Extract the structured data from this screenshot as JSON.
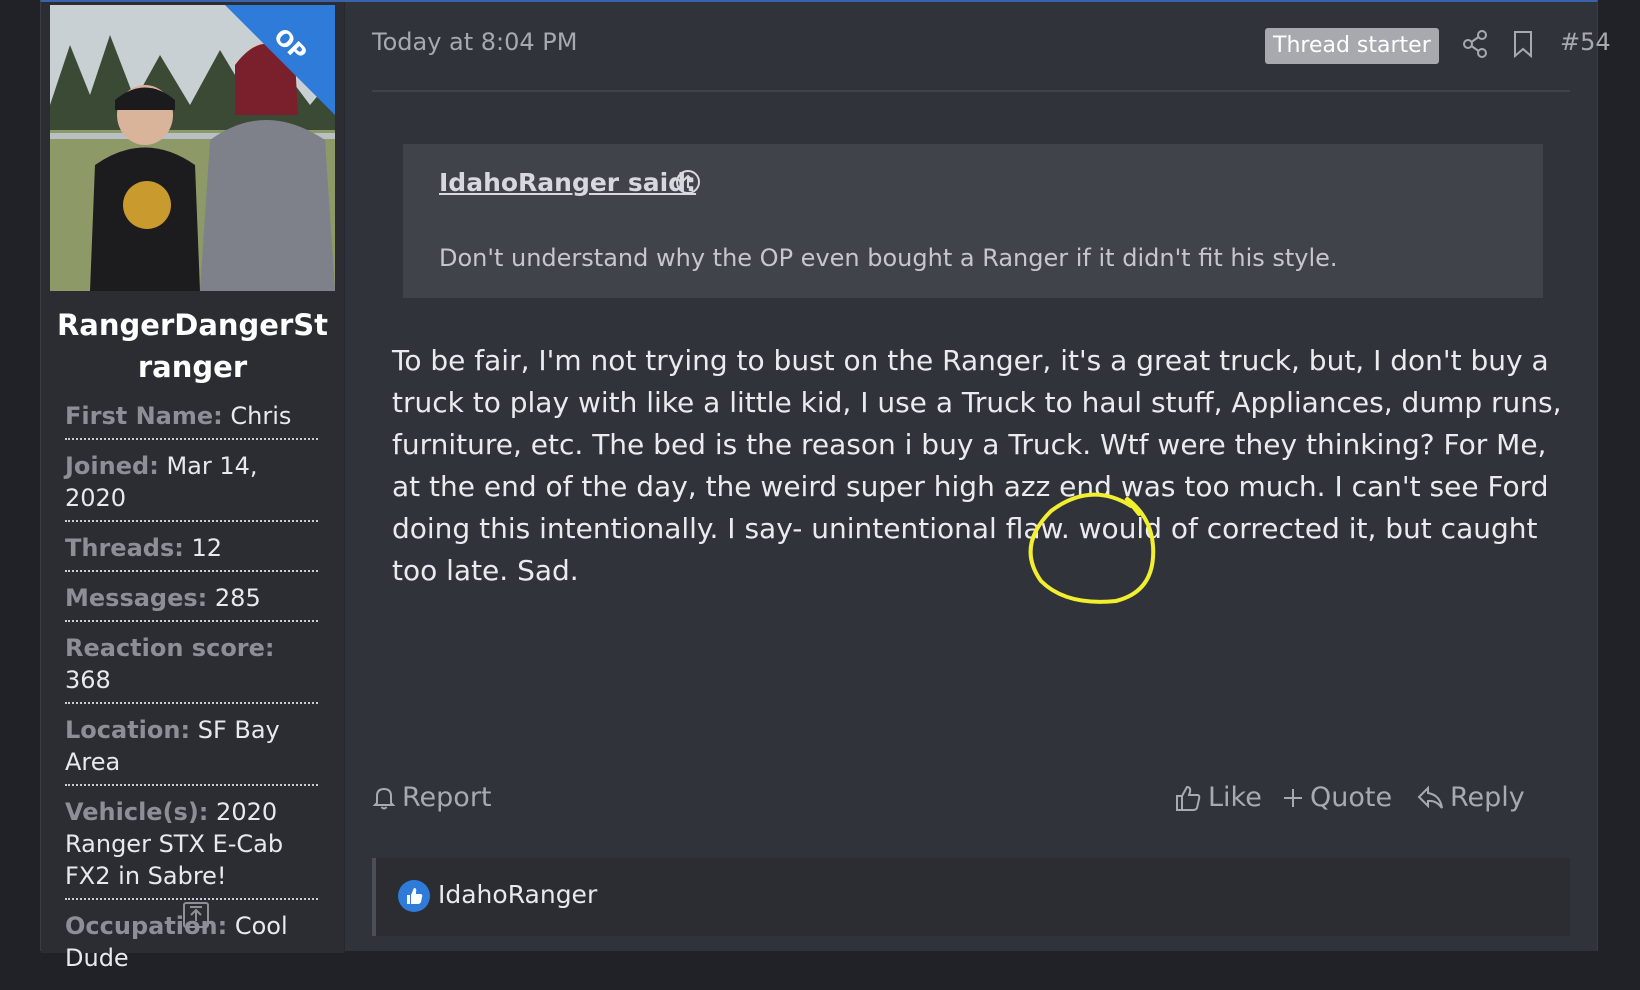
{
  "post": {
    "author": {
      "username": "RangerDangerStranger",
      "avatar_badge": "OP",
      "fields": [
        {
          "label": "First Name:",
          "value": "Chris"
        },
        {
          "label": "Joined:",
          "value": "Mar 14, 2020"
        },
        {
          "label": "Threads:",
          "value": "12"
        },
        {
          "label": "Messages:",
          "value": "285"
        },
        {
          "label": "Reaction score:",
          "value": "368"
        },
        {
          "label": "Location:",
          "value": "SF Bay Area"
        },
        {
          "label": "Vehicle(s):",
          "value": "2020 Ranger STX E-Cab FX2 in Sabre!"
        },
        {
          "label": "Occupation:",
          "value": "Cool Dude"
        }
      ]
    },
    "timestamp": "Today at 8:04 PM",
    "thread_starter_badge": "Thread starter",
    "post_number": "#54",
    "quote": {
      "author": "IdahoRanger said:",
      "text": "Don't understand why the OP even bought a Ranger if it didn't fit his style."
    },
    "body": "To be fair, I'm not trying to bust on the Ranger, it's a great truck, but, I don't buy a truck to play with like a little kid, I use a Truck to haul stuff, Appliances, dump runs, furniture, etc. The bed is the reason i buy a Truck. Wtf were they thinking? For Me, at the end of the day, the weird super high azz end was too much. I can't see Ford doing this intentionally. I say- unintentional flaw. would of corrected it, but caught too late. Sad.",
    "actions": {
      "report": "Report",
      "like": "Like",
      "quote": "Quote",
      "reply": "Reply"
    },
    "reactions": {
      "users": "IdahoRanger"
    }
  },
  "colors": {
    "background": "#31333a",
    "sidebar": "#2b2d33",
    "accent": "#2e7bd9",
    "annotation": "#f2ef2e"
  },
  "icons": [
    "share-icon",
    "bookmark-icon",
    "arrow-up-circle-icon",
    "bell-icon",
    "thumbs-up-icon",
    "plus-icon",
    "reply-icon",
    "collapse-icon"
  ]
}
